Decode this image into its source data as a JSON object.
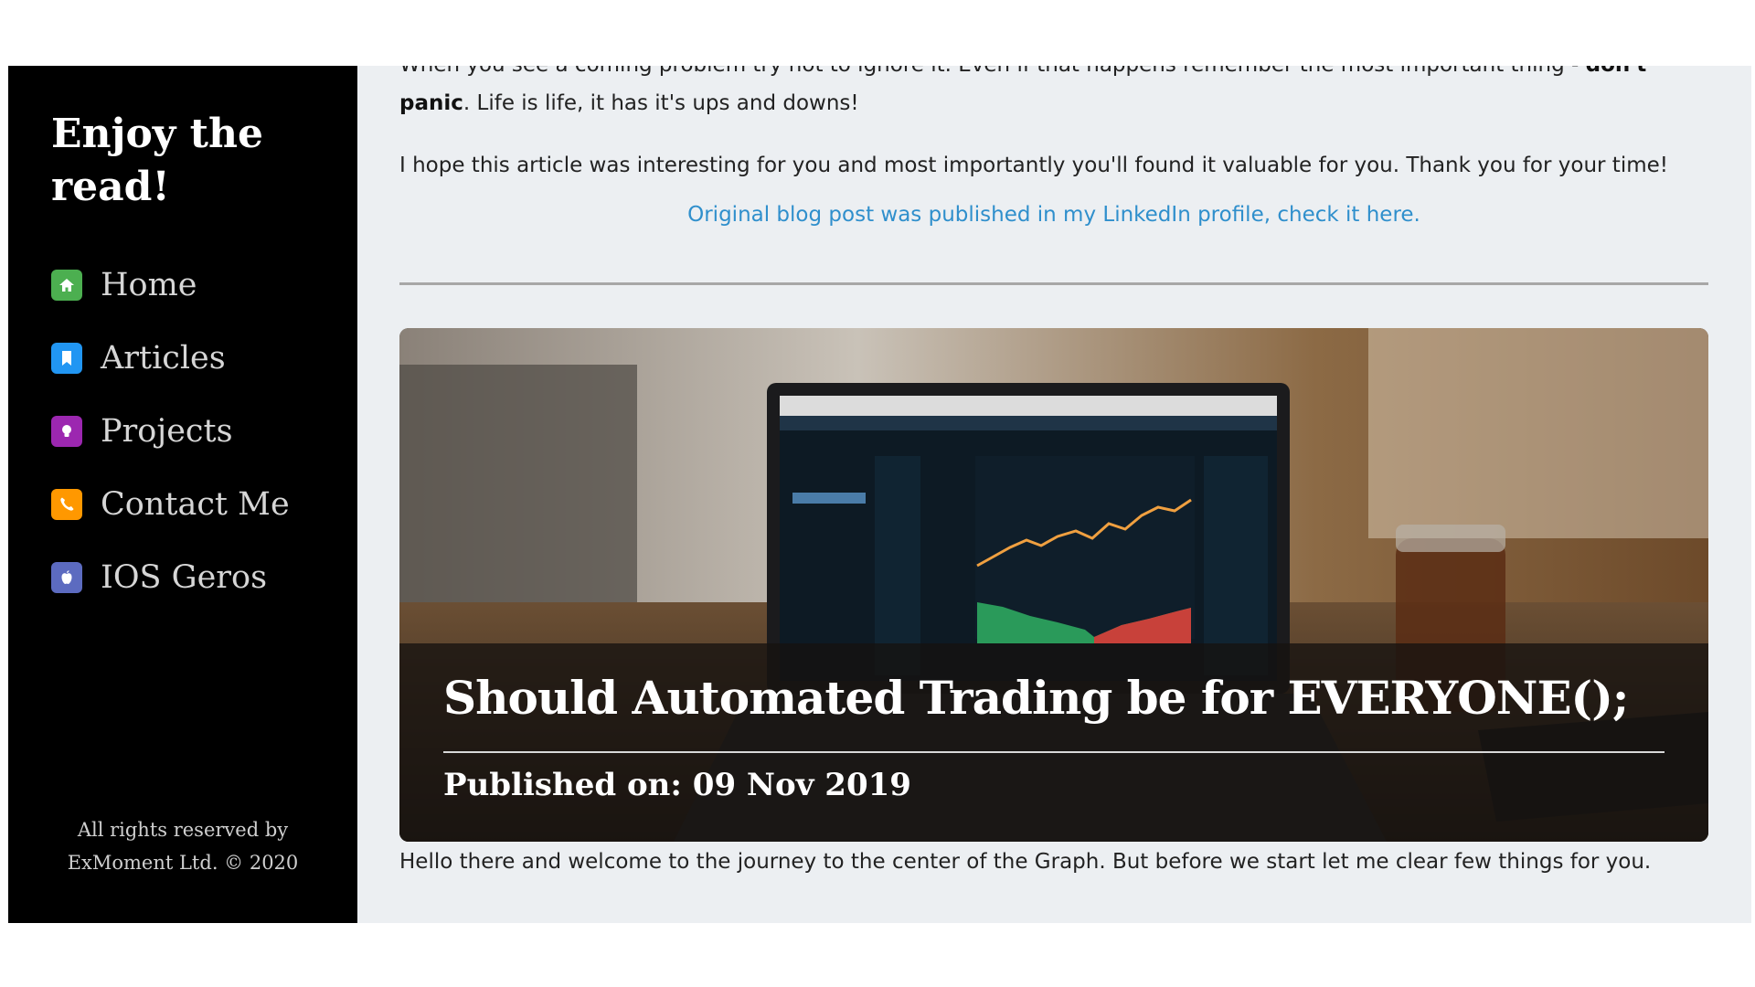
{
  "sidebar": {
    "title": "Enjoy the read!",
    "nav": [
      {
        "label": "Home",
        "icon": "home-icon",
        "color": "#4caf50"
      },
      {
        "label": "Articles",
        "icon": "bookmark-icon",
        "color": "#2196f3"
      },
      {
        "label": "Projects",
        "icon": "lightbulb-icon",
        "color": "#9c27b0"
      },
      {
        "label": "Contact Me",
        "icon": "phone-icon",
        "color": "#ff9800"
      },
      {
        "label": "IOS Geros",
        "icon": "apple-icon",
        "color": "#5c6bc0"
      }
    ],
    "footer": {
      "line1": "All rights reserved by",
      "line2": "ExMoment Ltd. © 2020"
    }
  },
  "article": {
    "para1_before": "When you see a coming problem try not to ignore it. Even if that happens remember the most important thing - ",
    "para1_strong": "don't panic",
    "para1_after": ". Life is life, it has it's ups and downs!",
    "para2": "I hope this article was interesting for you and most importantly you'll found it valuable for you. Thank you for your time!",
    "link_text": "Original blog post was published in my LinkedIn profile, check it here."
  },
  "next_post": {
    "title": "Should Automated Trading be for EVERYONE();",
    "published": "Published on: 09 Nov 2019",
    "intro": "Hello there and welcome to the journey to the center of the Graph. But before we start let me clear few things for you."
  },
  "colors": {
    "sidebar_bg": "#000000",
    "content_bg": "#eceff2",
    "link": "#2f8fcc"
  }
}
